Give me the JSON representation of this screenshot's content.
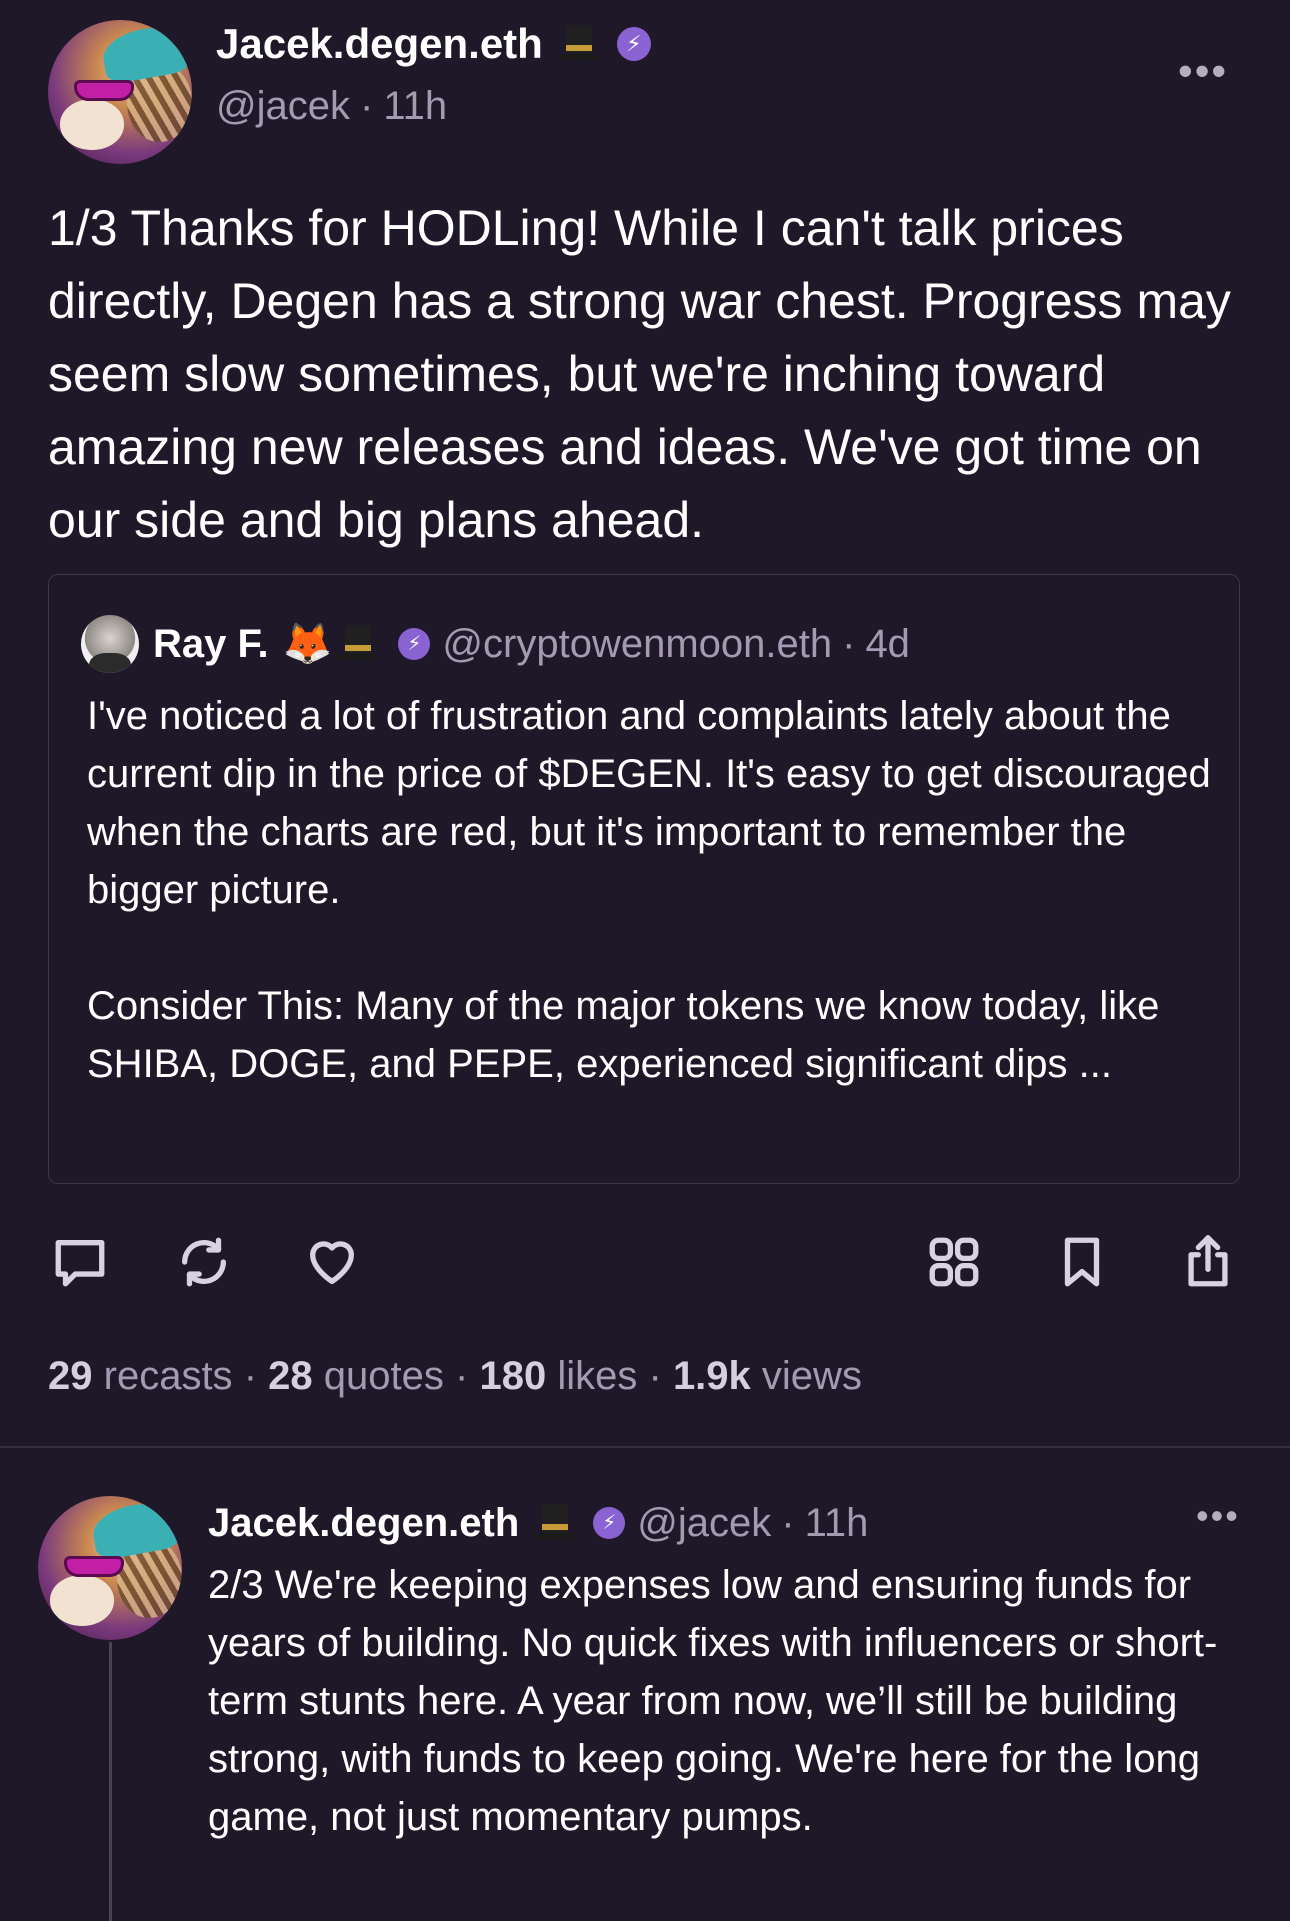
{
  "main_post": {
    "author_name": "Jacek.degen.eth",
    "handle": "@jacek",
    "time": "11h",
    "text": "1/3 Thanks for HODLing! While I can't talk prices directly, Degen has a strong war chest. Progress may seem slow sometimes, but we're inching toward amazing new releases and ideas. We've got time on our side and big plans ahead.",
    "quote": {
      "author_name": "Ray F.",
      "handle": "@cryptowenmoon.eth",
      "time": "4d",
      "text": "I've noticed a lot of frustration and complaints lately about the current dip in the price of $DEGEN. It's easy to get discouraged when the charts are red, but it's important to remember the bigger picture.\n\nConsider This: Many of the major tokens we know today, like SHIBA, DOGE, and PEPE, experienced significant dips ..."
    },
    "stats": {
      "recasts_count": "29",
      "recasts_label": "recasts",
      "quotes_count": "28",
      "quotes_label": "quotes",
      "likes_count": "180",
      "likes_label": "likes",
      "views_count": "1.9k",
      "views_label": "views",
      "separator": "·"
    }
  },
  "reply_post": {
    "author_name": "Jacek.degen.eth",
    "handle": "@jacek",
    "time": "11h",
    "text": "2/3 We're keeping expenses low and ensuring funds for years of building. No quick fixes with influencers or short-term stunts here. A year from now, we’ll still be building strong, with funds to keep going. We're here for the long game, not just momentary pumps."
  },
  "icons": {
    "badge": "power-badge-icon",
    "more": "more-options-icon",
    "reply": "comment-icon",
    "recast": "recast-icon",
    "like": "heart-icon",
    "apps": "grid-icon",
    "bookmark": "bookmark-icon",
    "share": "share-icon"
  },
  "colors": {
    "background": "#1f1829",
    "accent": "#8a63d2",
    "muted_text": "#a49bb3",
    "icon": "#d8d2e2"
  },
  "separator": "·"
}
